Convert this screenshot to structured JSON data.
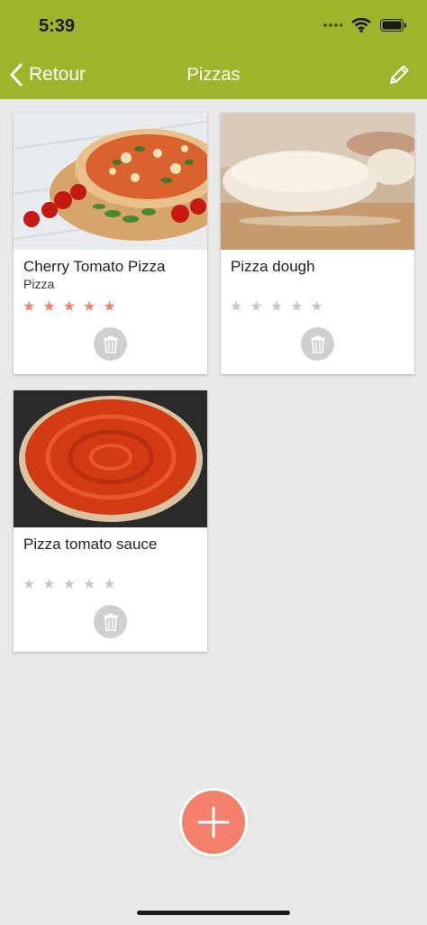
{
  "status": {
    "time": "5:39"
  },
  "nav": {
    "back_label": "Retour",
    "title": "Pizzas"
  },
  "recipes": [
    {
      "title": "Cherry Tomato Pizza",
      "subtitle": "Pizza",
      "rating": 5,
      "max_rating": 5
    },
    {
      "title": "Pizza dough",
      "subtitle": "",
      "rating": 0,
      "max_rating": 5
    },
    {
      "title": "Pizza tomato sauce",
      "subtitle": "",
      "rating": 0,
      "max_rating": 5
    }
  ],
  "colors": {
    "header": "#9db52b",
    "accent": "#f3806c",
    "star_on": "#f3806c",
    "star_off": "#c8c8c8"
  },
  "icons": [
    "chevron-left-icon",
    "pencil-icon",
    "trash-icon",
    "plus-icon",
    "wifi-icon",
    "battery-icon",
    "signal-icon"
  ]
}
